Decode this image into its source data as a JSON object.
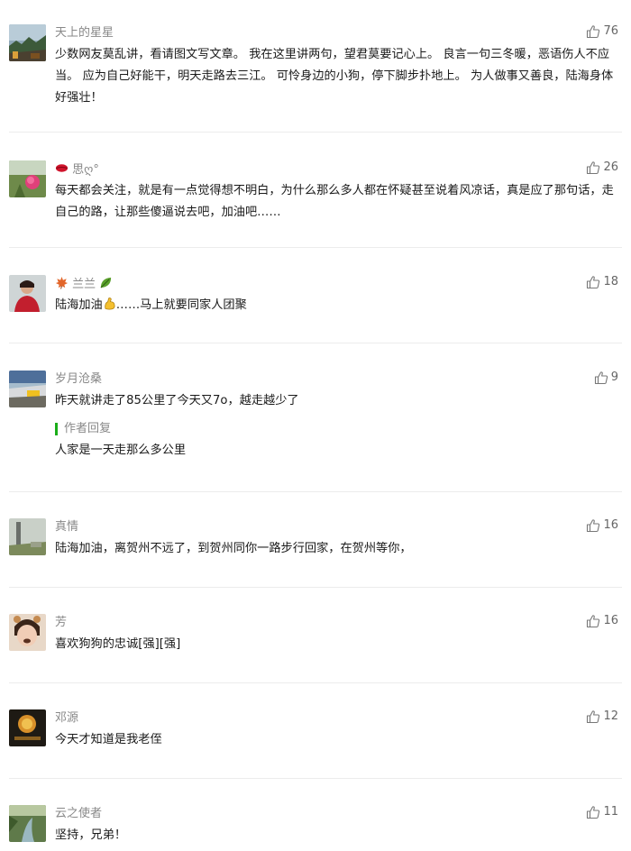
{
  "comments": [
    {
      "nickname": "天上的星星",
      "likes": "76",
      "content": "少数网友莫乱讲，看请图文写文章。 我在这里讲两句，望君莫要记心上。 良言一句三冬暖，恶语伤人不应当。 应为自己好能干，明天走路去三江。 可怜身边的小狗，停下脚步扑地上。 为人做事又善良，陆海身体好强壮！"
    },
    {
      "nickname_prefix_icon": "lips-emoji",
      "nickname": "思ღ°",
      "likes": "26",
      "content": "每天都会关注，就是有一点觉得想不明白，为什么那么多人都在怀疑甚至说着风凉话，真是应了那句话，走自己的路，让那些傻逼说去吧，加油吧……"
    },
    {
      "nickname_prefix_icon": "maple-leaf-emoji",
      "nickname": "兰兰",
      "nickname_suffix_icon": "green-leaf-emoji",
      "likes": "18",
      "content_before_icon": "陆海加油",
      "content_icon": "flexed-biceps-emoji",
      "content_after_icon": "……马上就要同家人团聚"
    },
    {
      "nickname": "岁月沧桑",
      "likes": "9",
      "content": "昨天就讲走了85公里了今天又7o，越走越少了",
      "author_reply_label": "作者回复",
      "author_reply": "人家是一天走那么多公里"
    },
    {
      "nickname": "真情",
      "likes": "16",
      "content": "陆海加油，离贺州不远了，到贺州同你一路步行回家，在贺州等你，"
    },
    {
      "nickname": "芳",
      "likes": "16",
      "content": "喜欢狗狗的忠诚[强][强]"
    },
    {
      "nickname": "邓源",
      "likes": "12",
      "content": "今天才知道是我老侄"
    },
    {
      "nickname": "云之使者",
      "likes": "11",
      "content": "坚持，兄弟！"
    }
  ],
  "colors": {
    "nickname": "#888888",
    "text": "#1a1a1a",
    "divider": "#ececec",
    "author_accent": "#1aad19"
  }
}
